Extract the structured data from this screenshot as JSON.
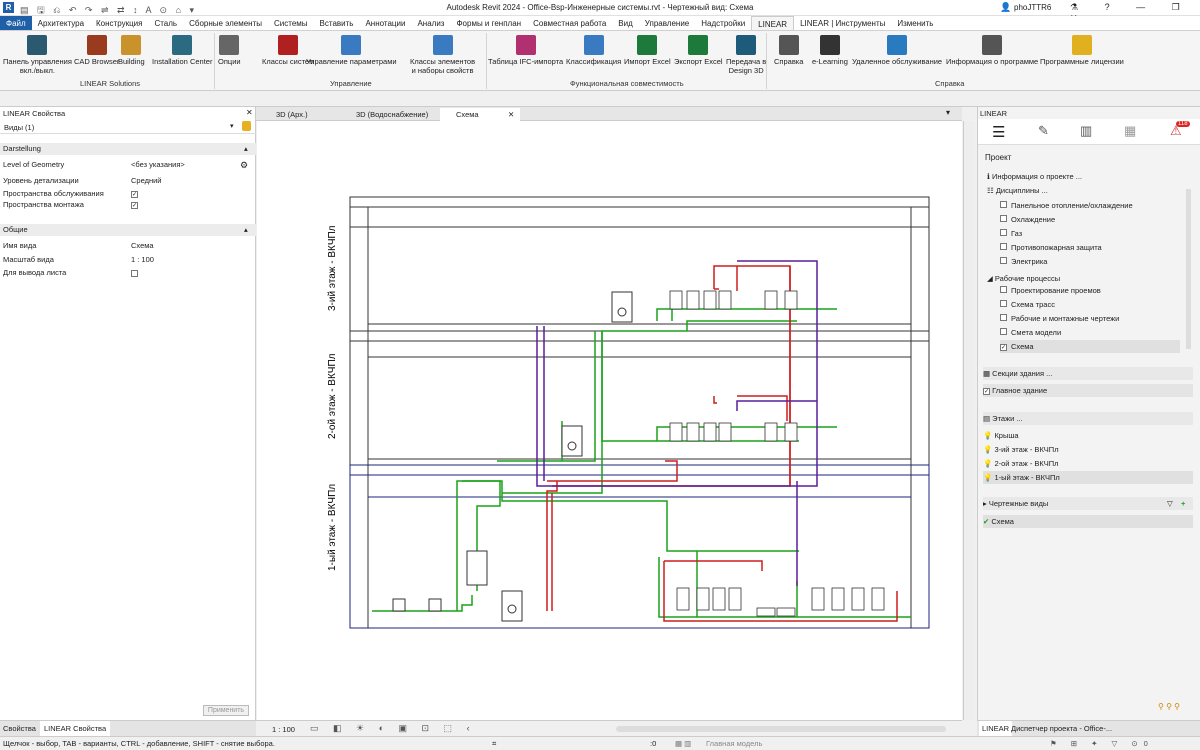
{
  "app": {
    "title": "Autodesk Revit 2024 - Office-Bsp-Инженерные системы.rvt - Чертежный вид: Схема",
    "user": "phoJTTR6"
  },
  "ribbon_tabs": [
    "Файл",
    "Архитектура",
    "Конструкция",
    "Сталь",
    "Сборные элементы",
    "Системы",
    "Вставить",
    "Аннотации",
    "Анализ",
    "Формы и генплан",
    "Совместная работа",
    "Вид",
    "Управление",
    "Надстройки",
    "LINEAR",
    "LINEAR | Инструменты",
    "Изменить"
  ],
  "ribbon": {
    "buttons": [
      {
        "label": "Панель управления\nвкл./выкл.",
        "icon": "linear-panel-icon",
        "color": "#2b5a70"
      },
      {
        "label": "CAD Browser",
        "icon": "cad-browser-icon",
        "color": "#9a3a1f"
      },
      {
        "label": "Building",
        "icon": "building-icon",
        "color": "#c9922a"
      },
      {
        "label": "Installation Center",
        "icon": "installation-center-icon",
        "color": "#2b6a80"
      },
      {
        "label": "Опции",
        "icon": "gears-icon",
        "color": "#666666"
      },
      {
        "label": "Классы систем",
        "icon": "system-classes-icon",
        "color": "#b02020"
      },
      {
        "label": "Управление параметрами",
        "icon": "parameters-icon",
        "color": "#3a7ac0"
      },
      {
        "label": "Классы элементов\nи наборы свойств",
        "icon": "element-classes-icon",
        "color": "#3a7ac0"
      },
      {
        "label": "Таблица IFC-импорта",
        "icon": "ifc-table-icon",
        "color": "#b03070"
      },
      {
        "label": "Классификация",
        "icon": "classification-icon",
        "color": "#3a7ac0"
      },
      {
        "label": "Импорт Excel",
        "icon": "excel-import-icon",
        "color": "#1e7a3a"
      },
      {
        "label": "Экспорт Excel",
        "icon": "excel-export-icon",
        "color": "#1e7a3a"
      },
      {
        "label": "Передача в\nDesign 3D",
        "icon": "design3d-icon",
        "color": "#1e5a7a"
      },
      {
        "label": "Справка",
        "icon": "help-book-icon",
        "color": "#555555"
      },
      {
        "label": "e-Learning",
        "icon": "elearning-icon",
        "color": "#333333"
      },
      {
        "label": "Удаленное обслуживание",
        "icon": "remote-service-icon",
        "color": "#2a7ac0"
      },
      {
        "label": "Информация о программе",
        "icon": "info-icon",
        "color": "#555555"
      },
      {
        "label": "Программные лицензии",
        "icon": "license-key-icon",
        "color": "#e0b020"
      }
    ],
    "groups": [
      "LINEAR Solutions",
      "Управление",
      "Функциональная совместимость",
      "Справка"
    ]
  },
  "properties": {
    "title": "LINEAR Свойства",
    "type_selector": "Виды (1)",
    "section_darstellung": "Darstellung",
    "lod_label": "Level of Geometry",
    "lod_value": "<без указания>",
    "detail_label": "Уровень детализации",
    "detail_value": "Средний",
    "service_space": "Пространства обслуживания",
    "install_space": "Пространства монтажа",
    "section_general": "Общие",
    "view_name_label": "Имя вида",
    "view_name_value": "Схема",
    "scale_label": "Масштаб вида",
    "scale_value": "1 : 100",
    "sheet_output": "Для вывода листа",
    "apply_button": "Применить",
    "tab_properties": "Свойства",
    "tab_linear": "LINEAR Свойства"
  },
  "view_tabs": [
    "3D (Арх.)",
    "3D (Водоснабжение)",
    "Схема"
  ],
  "drawing": {
    "floor3": "3-ий этаж - ВКЧПл",
    "floor2": "2-ой этаж - ВКЧПл",
    "floor1": "1-ый этаж - ВКЧПл"
  },
  "view_status": {
    "scale": "1 : 100"
  },
  "right_panel": {
    "title": "LINEAR",
    "project_label": "Проект",
    "project_info": "Информация о проекте ...",
    "disciplines": "Дисциплины ...",
    "discipline_items": [
      "Панельное отопление/охлаждение",
      "Охлаждение",
      "Газ",
      "Противопожарная защита",
      "Электрика"
    ],
    "workflows": "Рабочие процессы",
    "workflow_items": [
      "Проектирование проемов",
      "Схема трасс",
      "Рабочие и монтажные чертежи",
      "Смета модели",
      "Схема"
    ],
    "sections": "Секции здания ...",
    "main_building": "Главное здание",
    "floors": "Этажи ...",
    "floor_items": [
      "Крыша",
      "3-ий этаж - ВКЧПл",
      "2-ой этаж - ВКЧПл",
      "1-ый этаж - ВКЧПл"
    ],
    "drafting_views": "Чертежные виды",
    "drafting_item": "Схема",
    "badge": "118",
    "bottom_tab1": "LINEAR",
    "bottom_tab2": "Диспетчер проекта - Office-..."
  },
  "status_bar": {
    "hint": "Щелчок - выбор, TAB - варианты, CTRL - добавление, SHIFT - снятие выбора.",
    "model": "Главная модель",
    "zero": ":0"
  },
  "colors": {
    "supply": "#1aa31a",
    "return": "#cc1f1f",
    "circulation": "#5a1e9a",
    "level": "#1a237e"
  }
}
